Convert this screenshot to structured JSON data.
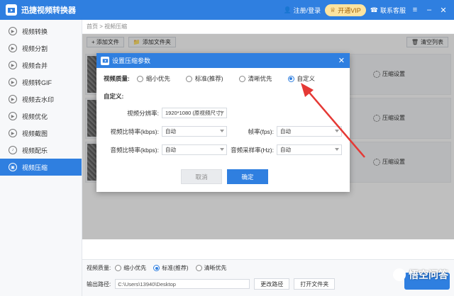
{
  "app": {
    "title": "迅捷视频转换器",
    "login": "注册/登录",
    "vip": "开通VIP",
    "support": "联系客服"
  },
  "sidebar": {
    "items": [
      {
        "label": "视频转换",
        "icon": "video-convert-icon"
      },
      {
        "label": "视频分割",
        "icon": "video-split-icon"
      },
      {
        "label": "视频合并",
        "icon": "video-merge-icon"
      },
      {
        "label": "视频转GIF",
        "icon": "gif-icon"
      },
      {
        "label": "视频去水印",
        "icon": "watermark-remove-icon"
      },
      {
        "label": "视频优化",
        "icon": "optimize-icon"
      },
      {
        "label": "视频截图",
        "icon": "screenshot-icon"
      },
      {
        "label": "视频配乐",
        "icon": "music-icon"
      },
      {
        "label": "视频压缩",
        "icon": "compress-icon"
      }
    ],
    "active_index": 8
  },
  "main": {
    "breadcrumb": "首页 > 视频压缩",
    "add_file": "+ 添加文件",
    "add_folder": "添加文件夹",
    "clear_list": "清空列表",
    "row_setting": "压缩设置"
  },
  "bottom": {
    "quality_label": "视频质量:",
    "quality_options": [
      "缩小优先",
      "标准(推荐)",
      "清晰优先"
    ],
    "quality_selected": 1,
    "output_label": "输出路径:",
    "output_path": "C:\\Users\\13940\\Desktop",
    "change_path": "更改路径",
    "open_folder": "打开文件夹"
  },
  "dialog": {
    "title": "设置压缩参数",
    "quality_label": "视频质量:",
    "quality_options": [
      "缩小优先",
      "标准(推荐)",
      "清晰优先",
      "自定义"
    ],
    "quality_selected": 3,
    "custom_title": "自定义:",
    "resolution_label": "视频分辨率:",
    "resolution_value": "1920*1080 (原视频尺寸)",
    "video_bitrate_label": "视频比特率(kbps):",
    "video_bitrate_value": "自动",
    "fps_label": "帧率(fps):",
    "fps_value": "自动",
    "audio_bitrate_label": "音频比特率(kbps):",
    "audio_bitrate_value": "自动",
    "audio_samplerate_label": "音频采样率(Hz):",
    "audio_samplerate_value": "自动",
    "cancel": "取消",
    "ok": "确定"
  },
  "watermark": {
    "text": "悟空问答"
  },
  "colors": {
    "accent": "#2f7fe0",
    "arrow": "#e53935"
  }
}
